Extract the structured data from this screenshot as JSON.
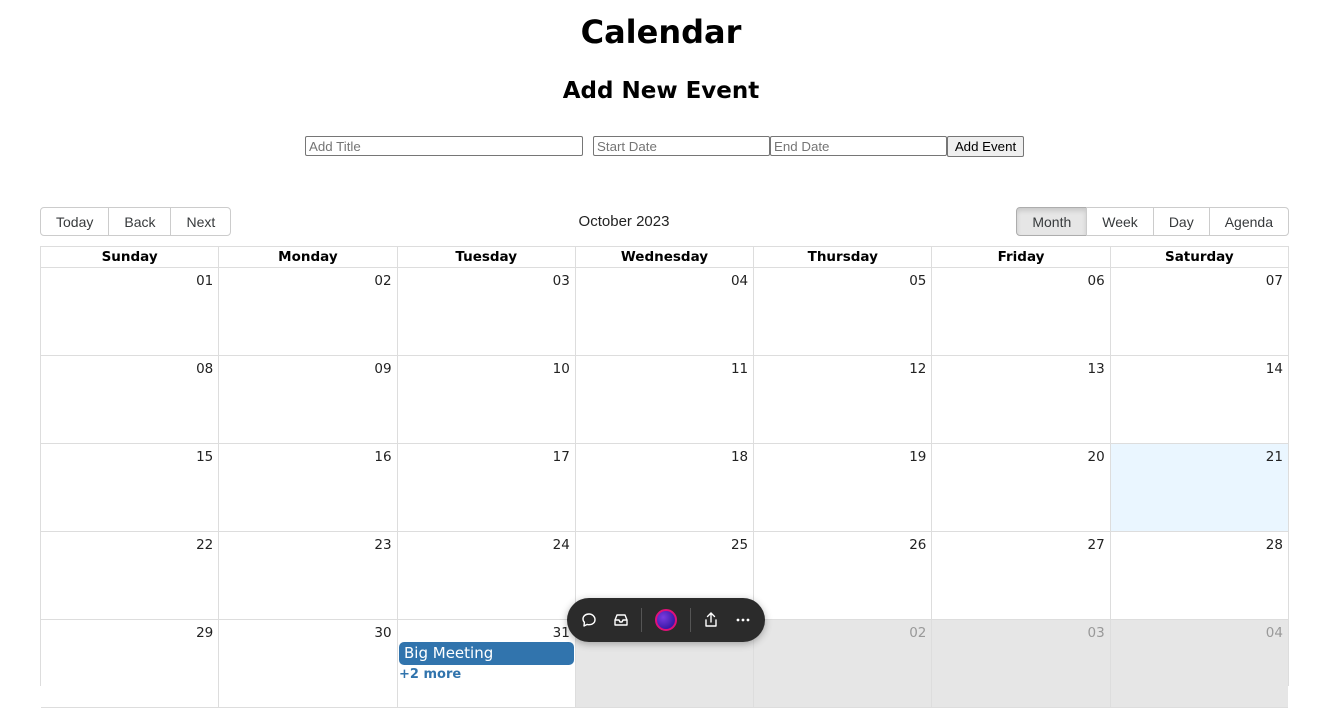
{
  "page_title": "Calendar",
  "form": {
    "title": "Add New Event",
    "title_placeholder": "Add Title",
    "start_placeholder": "Start Date",
    "end_placeholder": "End Date",
    "submit_label": "Add Event"
  },
  "toolbar": {
    "today_label": "Today",
    "back_label": "Back",
    "next_label": "Next",
    "current_label": "October 2023",
    "views": [
      "Month",
      "Week",
      "Day",
      "Agenda"
    ],
    "active_view": "Month"
  },
  "weekdays": [
    "Sunday",
    "Monday",
    "Tuesday",
    "Wednesday",
    "Thursday",
    "Friday",
    "Saturday"
  ],
  "weeks": [
    [
      "01",
      "02",
      "03",
      "04",
      "05",
      "06",
      "07"
    ],
    [
      "08",
      "09",
      "10",
      "11",
      "12",
      "13",
      "14"
    ],
    [
      "15",
      "16",
      "17",
      "18",
      "19",
      "20",
      "21"
    ],
    [
      "22",
      "23",
      "24",
      "25",
      "26",
      "27",
      "28"
    ],
    [
      "29",
      "30",
      "31",
      "02",
      "03",
      "04"
    ]
  ],
  "today_date": "21",
  "events": [
    {
      "title": "Big Meeting",
      "date": "31"
    }
  ],
  "more_label": "+2 more",
  "floating_toolbar": {
    "icons": [
      "chat-bubble-icon",
      "inbox-icon",
      "avatar",
      "share-icon",
      "more-icon"
    ],
    "avatar_ring_color": "#e0107a"
  },
  "colors": {
    "event": "#3174ad",
    "today_bg": "#eaf6ff",
    "off_range_bg": "#e6e6e6"
  }
}
